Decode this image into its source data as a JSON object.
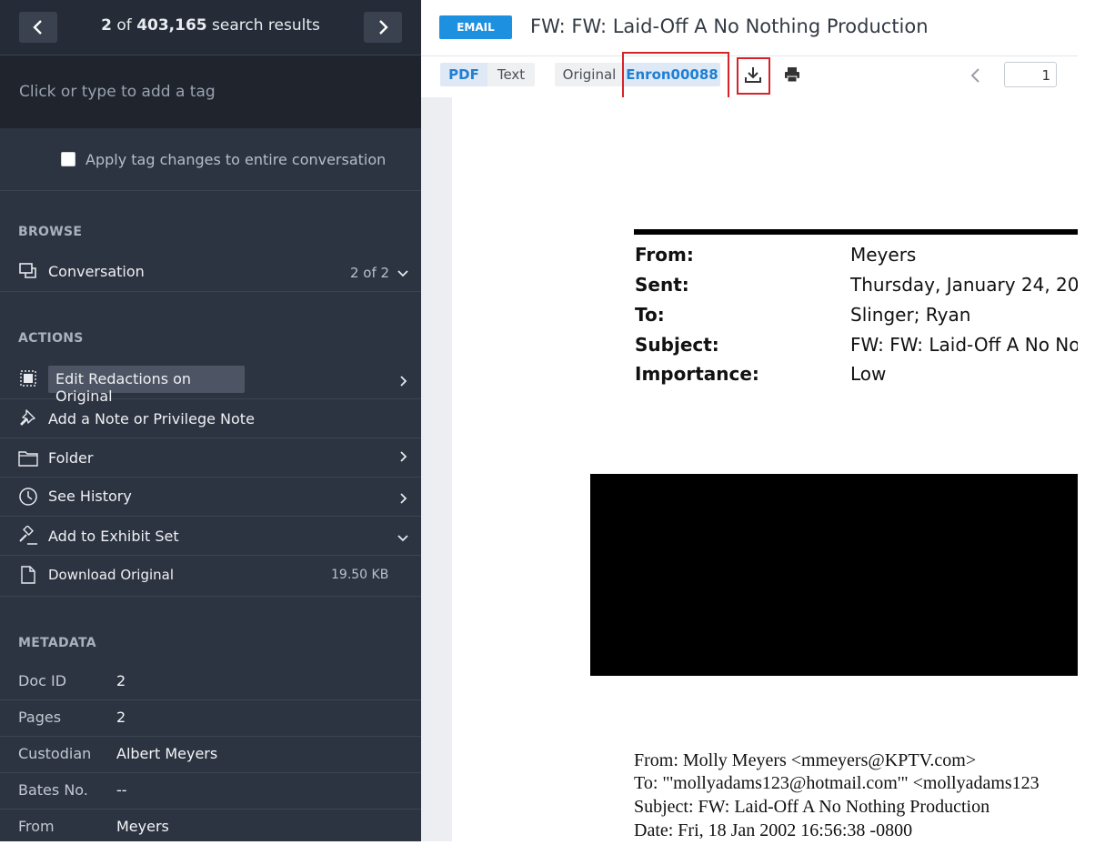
{
  "nav": {
    "results_current": "2",
    "results_of": " of ",
    "results_total": "403,165",
    "results_suffix": " search results"
  },
  "tag": {
    "placeholder": "Click or type to add a tag"
  },
  "apply": {
    "label": "Apply tag changes to entire conversation"
  },
  "browse": {
    "title": "BROWSE",
    "conversation_label": "Conversation",
    "conversation_count": "2 of 2"
  },
  "actions": {
    "title": "ACTIONS",
    "edit_redactions": "Edit Redactions on Original",
    "add_note": "Add a Note or Privilege Note",
    "folder": "Folder",
    "see_history": "See History",
    "exhibit": "Add to Exhibit Set",
    "download": "Download Original",
    "download_size": "19.50 KB"
  },
  "metadata": {
    "title": "METADATA",
    "rows": [
      {
        "key": "Doc ID",
        "value": "2"
      },
      {
        "key": "Pages",
        "value": "2"
      },
      {
        "key": "Custodian",
        "value": "Albert Meyers"
      },
      {
        "key": "Bates No.",
        "value": "--"
      },
      {
        "key": "From",
        "value": "Meyers"
      }
    ]
  },
  "doc": {
    "badge": "EMAIL",
    "title": "FW: FW: Laid-Off A No Nothing Production"
  },
  "toolbar": {
    "pdf": "PDF",
    "text": "Text",
    "original": "Original",
    "bates": "Enron00088",
    "page": "1"
  },
  "email": {
    "fields": [
      {
        "key": "From:",
        "value": "Meyers"
      },
      {
        "key": "Sent:",
        "value": "Thursday, January 24, 20"
      },
      {
        "key": "To:",
        "value": "Slinger; Ryan"
      },
      {
        "key": "Subject:",
        "value": "FW: FW: Laid-Off A No No"
      },
      {
        "key": "Importance:",
        "value": "Low"
      }
    ],
    "body": [
      "From: Molly Meyers <mmeyers@KPTV.com>",
      "To: \"'mollyadams123@hotmail.com'\" <mollyadams123",
      "Subject: FW: Laid-Off A No Nothing Production",
      "Date: Fri, 18 Jan 2002 16:56:38 -0800"
    ]
  },
  "colors": {
    "sidebar": "#2d3441",
    "accent": "#1e90e0",
    "highlight": "#d6232a"
  }
}
